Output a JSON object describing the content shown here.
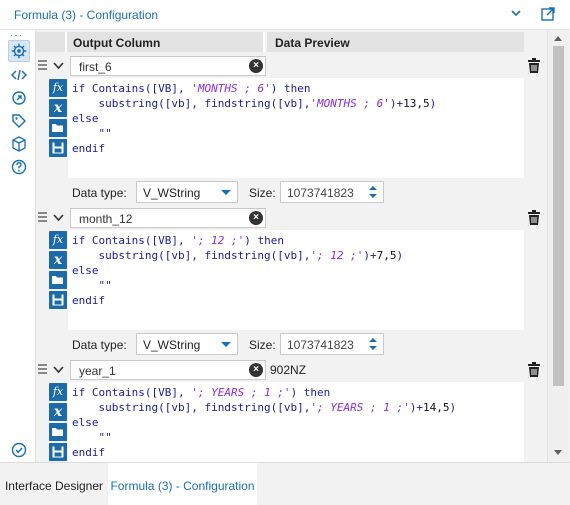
{
  "window": {
    "title": "Formula (3) - Configuration"
  },
  "side_icons": [
    "settings-icon",
    "code-icon",
    "map-icon",
    "tag-icon",
    "box-icon",
    "help-icon"
  ],
  "grid": {
    "col_output": "Output Column",
    "col_preview": "Data Preview"
  },
  "rows": [
    {
      "name": "first_6",
      "preview": "",
      "code": {
        "l1a": "if Contains([VB], ",
        "l1s": "'MONTHS ; 6'",
        "l1b": ") then",
        "l2a": "    substring([vb], findstring([vb],",
        "l2s": "'MONTHS ; 6'",
        "l2b": ")+",
        "l2n": "13,5",
        "l2c": ")",
        "l3": "else",
        "l4": "    \"\"",
        "l5": "endif"
      },
      "data_type_label": "Data type:",
      "data_type": "V_WString",
      "size_label": "Size:",
      "size": "1073741823"
    },
    {
      "name": "month_12",
      "preview": "",
      "code": {
        "l1a": "if Contains([VB], ",
        "l1s": "'; 12 ;'",
        "l1b": ") then",
        "l2a": "    substring([vb], findstring([vb],",
        "l2s": "'; 12 ;'",
        "l2b": ")+",
        "l2n": "7,5",
        "l2c": ")",
        "l3": "else",
        "l4": "    \"\"",
        "l5": "endif"
      },
      "data_type_label": "Data type:",
      "data_type": "V_WString",
      "size_label": "Size:",
      "size": "1073741823"
    },
    {
      "name": "year_1",
      "preview": "902NZ",
      "code": {
        "l1a": "if Contains([VB], ",
        "l1s": "'; YEARS ; 1 ;'",
        "l1b": ") then",
        "l2a": "    substring([vb], findstring([vb],",
        "l2s": "'; YEARS ; 1 ;'",
        "l2b": ")+",
        "l2n": "14,5",
        "l2c": ")",
        "l3": "else",
        "l4": "    \"\"",
        "l5": "endif"
      }
    }
  ],
  "tools": [
    "fx",
    "x"
  ],
  "footer": {
    "tab1": "Interface Designer",
    "tab2": "Formula (3) - Configuration"
  },
  "colors": {
    "accent": "#1a6fb3",
    "tool_bg": "#1d6aa8"
  }
}
